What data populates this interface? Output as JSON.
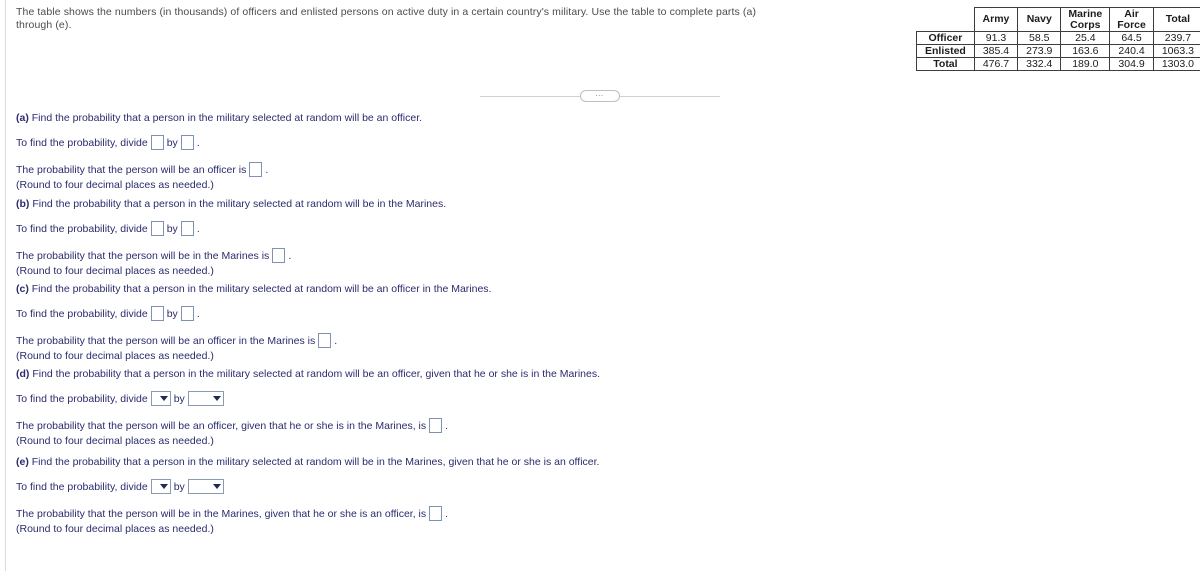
{
  "prompt": "The table shows the numbers (in thousands) of officers and enlisted persons on active duty in a certain country's military. Use the table to complete parts (a) through (e).",
  "divider": {
    "pill_label": "⋯"
  },
  "table": {
    "corner_label": "",
    "columns": [
      "Army",
      "Navy",
      "Marine Corps",
      "Air Force",
      "Total"
    ],
    "column_lines": [
      [
        "Army"
      ],
      [
        "Navy"
      ],
      [
        "Marine",
        "Corps"
      ],
      [
        "Air",
        "Force"
      ],
      [
        "Total"
      ]
    ],
    "rows": [
      {
        "label": "Officer",
        "values": [
          "91.3",
          "58.5",
          "25.4",
          "64.5",
          "239.7"
        ]
      },
      {
        "label": "Enlisted",
        "values": [
          "385.4",
          "273.9",
          "163.6",
          "240.4",
          "1063.3"
        ]
      },
      {
        "label": "Total",
        "values": [
          "476.7",
          "332.4",
          "189.0",
          "304.9",
          "1303.0"
        ]
      }
    ]
  },
  "labels": {
    "divide_prefix": "To find the probability, divide",
    "by": "by",
    "period": ".",
    "round_note": "(Round to four decimal places as needed.)"
  },
  "parts": [
    {
      "tag": "(a)",
      "question": " Find the probability that a person in the military selected at random will be an officer.",
      "answer_prefix": "The probability that the person will be an officer is",
      "answer_suffix": ".",
      "input_kind": "box"
    },
    {
      "tag": "(b)",
      "question": " Find the probability that a person in the military selected at random will be in the Marines.",
      "answer_prefix": "The probability that the person will be in the Marines is",
      "answer_suffix": ".",
      "input_kind": "box"
    },
    {
      "tag": "(c)",
      "question": " Find the probability that a person in the military selected at random will be an officer in the Marines.",
      "answer_prefix": "The probability that the person will be an officer in the Marines is",
      "answer_suffix": ".",
      "input_kind": "box"
    },
    {
      "tag": "(d)",
      "question": " Find the probability that a person in the military selected at random will be an officer, given that he or she is in the Marines.",
      "answer_prefix": "The probability that the person will be an officer, given that he or she is in the Marines, is",
      "answer_suffix": ".",
      "input_kind": "dropdown"
    },
    {
      "tag": "(e)",
      "question": " Find the probability that a person in the military selected at random will be in the Marines, given that he or she is an officer.",
      "answer_prefix": "The probability that the person will be in the Marines, given that he or she is an officer, is",
      "answer_suffix": ".",
      "input_kind": "dropdown"
    }
  ]
}
